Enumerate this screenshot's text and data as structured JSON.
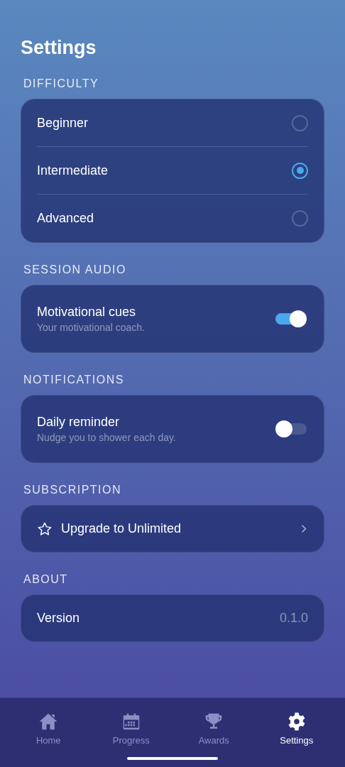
{
  "title": "Settings",
  "sections": [
    {
      "kind": "radio",
      "header": "DIFFICULTY",
      "options": [
        {
          "label": "Beginner",
          "selected": false
        },
        {
          "label": "Intermediate",
          "selected": true
        },
        {
          "label": "Advanced",
          "selected": false
        }
      ]
    },
    {
      "kind": "toggle",
      "header": "SESSION AUDIO",
      "label": "Motivational cues",
      "description": "Your motivational coach.",
      "on": true
    },
    {
      "kind": "toggle",
      "header": "NOTIFICATIONS",
      "label": "Daily reminder",
      "description": "Nudge you to shower each day.",
      "on": false
    },
    {
      "kind": "link",
      "header": "SUBSCRIPTION",
      "label": "Upgrade to Unlimited"
    },
    {
      "kind": "value",
      "header": "ABOUT",
      "label": "Version",
      "value": "0.1.0"
    }
  ],
  "nav": [
    {
      "label": "Home",
      "selected": false
    },
    {
      "label": "Progress",
      "selected": false
    },
    {
      "label": "Awards",
      "selected": false
    },
    {
      "label": "Settings",
      "selected": true
    }
  ]
}
